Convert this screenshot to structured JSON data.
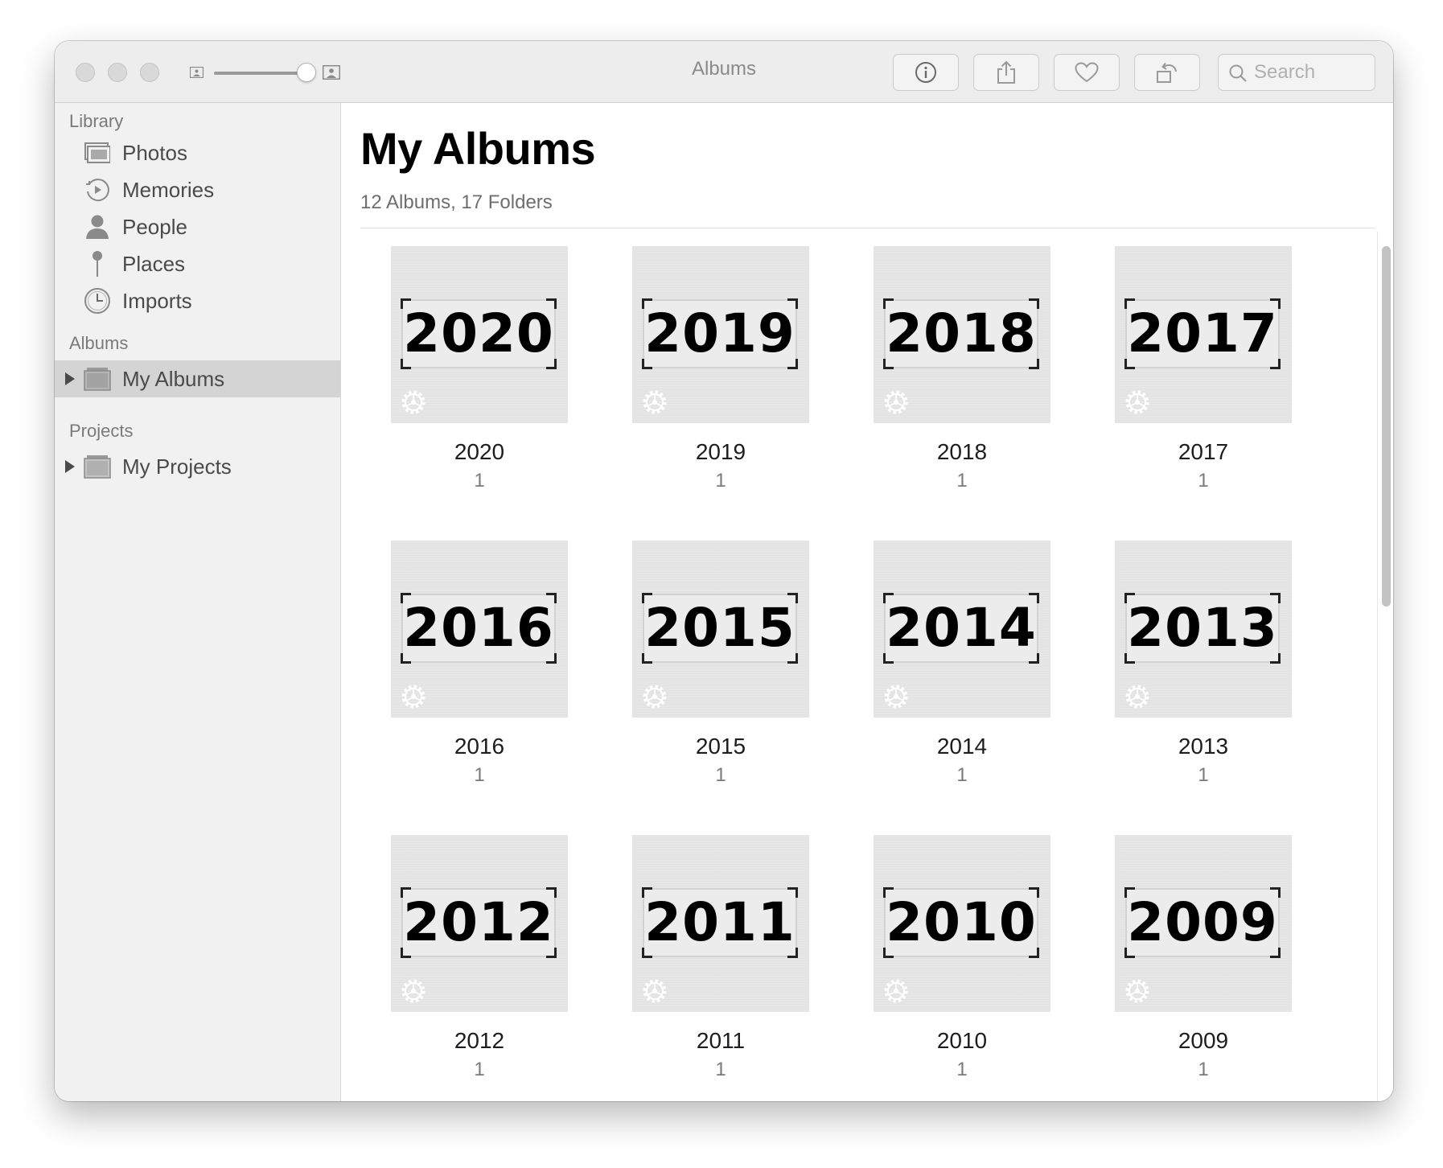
{
  "window": {
    "title": "Albums",
    "search_placeholder": "Search"
  },
  "toolbar": {
    "buttons": [
      "info-icon",
      "share-icon",
      "heart-icon",
      "rotate-icon"
    ]
  },
  "sidebar": {
    "library_header": "Library",
    "library_items": [
      {
        "label": "Photos",
        "icon": "photos-icon"
      },
      {
        "label": "Memories",
        "icon": "memories-icon"
      },
      {
        "label": "People",
        "icon": "person-icon"
      },
      {
        "label": "Places",
        "icon": "pin-icon"
      },
      {
        "label": "Imports",
        "icon": "clock-icon"
      }
    ],
    "albums_header": "Albums",
    "albums_item": "My Albums",
    "projects_header": "Projects",
    "projects_item": "My Projects"
  },
  "main": {
    "title": "My Albums",
    "subtitle": "12 Albums, 17 Folders",
    "albums": [
      {
        "name": "2020",
        "count": "1"
      },
      {
        "name": "2019",
        "count": "1"
      },
      {
        "name": "2018",
        "count": "1"
      },
      {
        "name": "2017",
        "count": "1"
      },
      {
        "name": "2016",
        "count": "1"
      },
      {
        "name": "2015",
        "count": "1"
      },
      {
        "name": "2014",
        "count": "1"
      },
      {
        "name": "2013",
        "count": "1"
      },
      {
        "name": "2012",
        "count": "1"
      },
      {
        "name": "2011",
        "count": "1"
      },
      {
        "name": "2010",
        "count": "1"
      },
      {
        "name": "2009",
        "count": "1"
      }
    ]
  },
  "colors": {
    "sidebar_bg": "#f1f1f1",
    "selected_bg": "#d4d4d4",
    "titlebar_bg": "#ededed"
  }
}
